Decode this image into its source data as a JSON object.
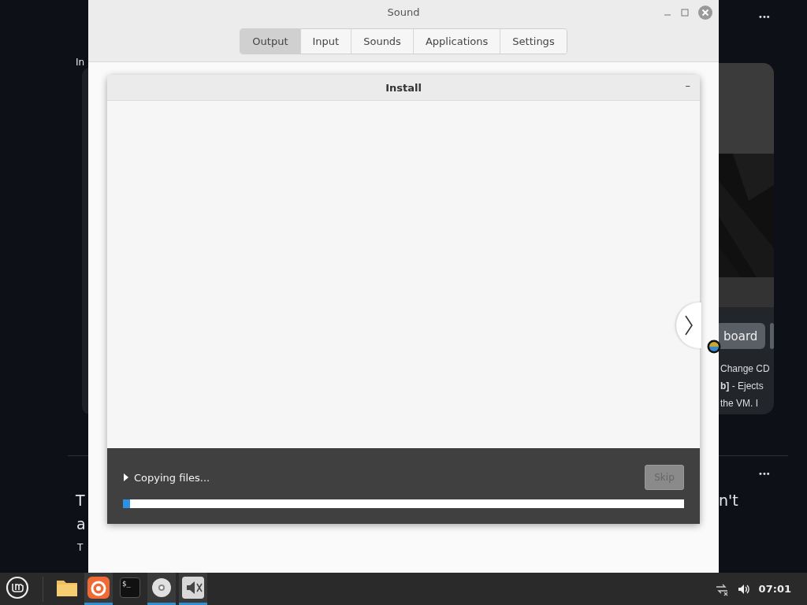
{
  "background": {
    "left_fragments": [
      "In",
      "T",
      "a",
      "T"
    ],
    "right_fragments": [
      "n't"
    ],
    "card": {
      "button": "board",
      "lines": [
        "Change CD",
        "**b]** - Ejects",
        "the VM. I"
      ]
    },
    "more_menus": [
      "•••",
      "•••"
    ]
  },
  "sound_window": {
    "title": "Sound",
    "tabs": [
      {
        "label": "Output",
        "selected": true
      },
      {
        "label": "Input",
        "selected": false
      },
      {
        "label": "Sounds",
        "selected": false
      },
      {
        "label": "Applications",
        "selected": false
      },
      {
        "label": "Settings",
        "selected": false
      }
    ]
  },
  "install_dialog": {
    "title": "Install",
    "minimize": "–",
    "status": "Copying files...",
    "details_expanded": false,
    "skip": {
      "label": "Skip",
      "disabled": true
    },
    "progress": {
      "level": 0.012
    }
  },
  "taskbar": {
    "apps": [
      {
        "kind": "folder",
        "active": false
      },
      {
        "kind": "browser",
        "active": true
      },
      {
        "kind": "terminal",
        "glyph": "$_",
        "active": false
      },
      {
        "kind": "disc",
        "active": true
      },
      {
        "kind": "sound",
        "active": true
      }
    ],
    "clock": "07:01"
  }
}
